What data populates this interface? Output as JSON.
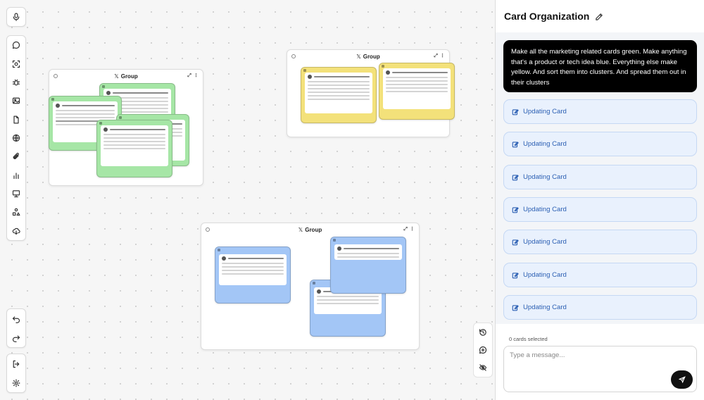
{
  "panel": {
    "title": "Card Organization",
    "user_message": "Make all the marketing related cards green. Make anything that's a product or tech idea blue. Everything else make yellow. And sort them into clusters. And spread them out in their clusters",
    "updates": [
      "Updating Card",
      "Updating Card",
      "Updating Card",
      "Updating Card",
      "Updating Card",
      "Updating Card",
      "Updating Card"
    ],
    "selected_count": "0 cards selected",
    "input_placeholder": "Type a message..."
  },
  "groups": [
    {
      "label": "Group",
      "color": "green"
    },
    {
      "label": "Group",
      "color": "yellow"
    },
    {
      "label": "Group",
      "color": "blue"
    }
  ],
  "toolbar": {
    "top_tools": [
      "chat-icon",
      "scan-icon",
      "bug-icon",
      "image-icon",
      "document-icon",
      "globe-icon",
      "paperclip-icon",
      "bar-chart-icon",
      "presentation-icon",
      "shapes-icon",
      "cloud-download-icon"
    ],
    "bottom_tools": [
      "undo-icon",
      "redo-icon"
    ],
    "footer_tools": [
      "logout-icon",
      "settings-icon"
    ]
  },
  "colors": {
    "green_card": "#a6e6a6",
    "yellow_card": "#f3e17a",
    "blue_card": "#a3c6f6",
    "update_text": "#2b5fb3"
  }
}
